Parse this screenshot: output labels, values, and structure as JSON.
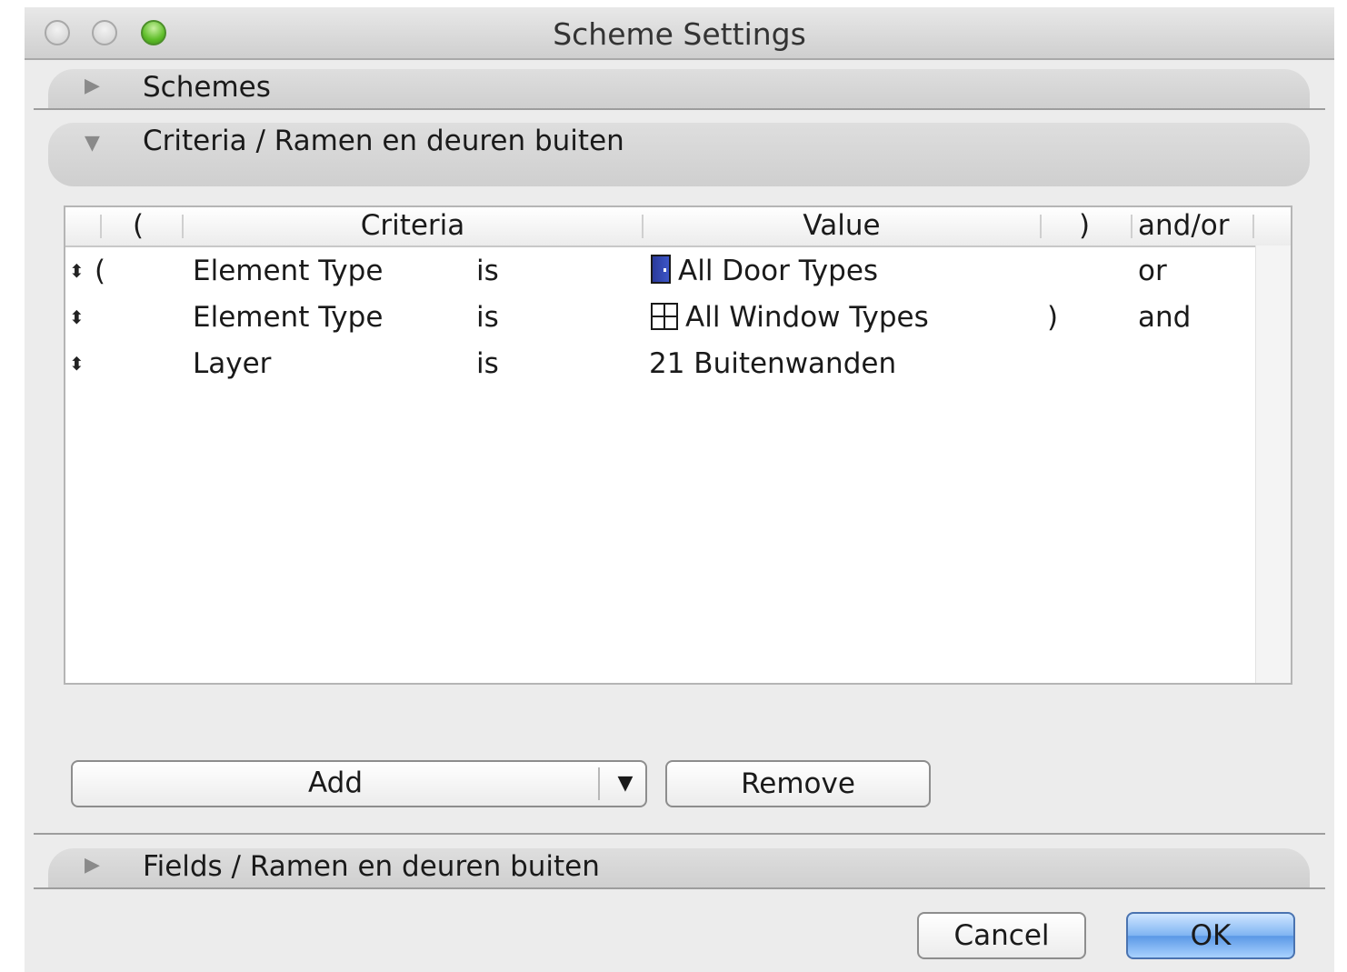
{
  "window": {
    "title": "Scheme Settings"
  },
  "sections": {
    "schemes": {
      "label": "Schemes",
      "state_icon": "disclosure-right-icon"
    },
    "criteria": {
      "label": "Criteria /  Ramen en deuren buiten",
      "state_icon": "disclosure-down-icon"
    },
    "fields": {
      "label": "Fields /  Ramen en deuren buiten",
      "state_icon": "disclosure-right-icon"
    }
  },
  "table": {
    "columns": {
      "open_paren": "(",
      "criteria": "Criteria",
      "value": "Value",
      "close_paren": ")",
      "and_or": "and/or"
    },
    "rows": [
      {
        "open_paren": "(",
        "criteria": "Element Type",
        "operator": "is",
        "value_icon": "door-icon",
        "value": "All Door Types",
        "close_paren": "",
        "and_or": "or"
      },
      {
        "open_paren": "",
        "criteria": "Element Type",
        "operator": "is",
        "value_icon": "window-icon",
        "value": "All Window Types",
        "close_paren": ")",
        "and_or": "and"
      },
      {
        "open_paren": "",
        "criteria": "Layer",
        "operator": "is",
        "value_icon": "",
        "value": "21 Buitenwanden",
        "close_paren": "",
        "and_or": ""
      }
    ]
  },
  "buttons": {
    "add": "Add",
    "remove": "Remove",
    "cancel": "Cancel",
    "ok": "OK"
  },
  "colors": {
    "window_bg": "#ececec",
    "default_button": "#7fb4f2",
    "zoom_button": "#5fbe2a"
  }
}
